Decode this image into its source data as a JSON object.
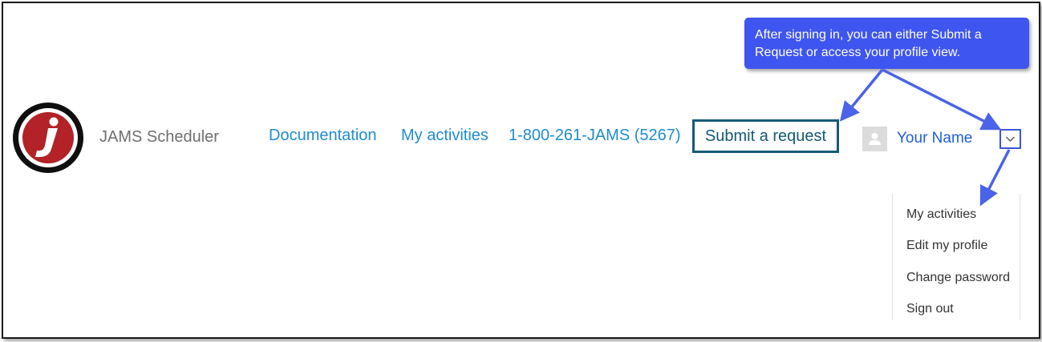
{
  "header": {
    "brand_name": "JAMS Scheduler",
    "logo_icon": "jams-j-logo-icon",
    "nav": {
      "documentation": "Documentation",
      "my_activities": "My activities",
      "phone": "1-800-261-JAMS (5267)"
    },
    "submit_request_label": "Submit a request",
    "user": {
      "name": "Your Name",
      "avatar_icon": "user-avatar-icon",
      "toggle_icon": "chevron-down-icon"
    }
  },
  "user_menu": {
    "items": [
      {
        "label": "My activities"
      },
      {
        "label": "Edit my profile"
      },
      {
        "label": "Change password"
      },
      {
        "label": "Sign out"
      }
    ]
  },
  "callout": {
    "text": "After signing in, you can either Submit a Request or access your profile view."
  },
  "colors": {
    "link": "#1f8ccf",
    "button_border": "#155a77",
    "user_name": "#1f5fd8",
    "callout_bg": "#3f55f0",
    "arrow": "#4a63e8",
    "logo_red": "#b22226"
  }
}
